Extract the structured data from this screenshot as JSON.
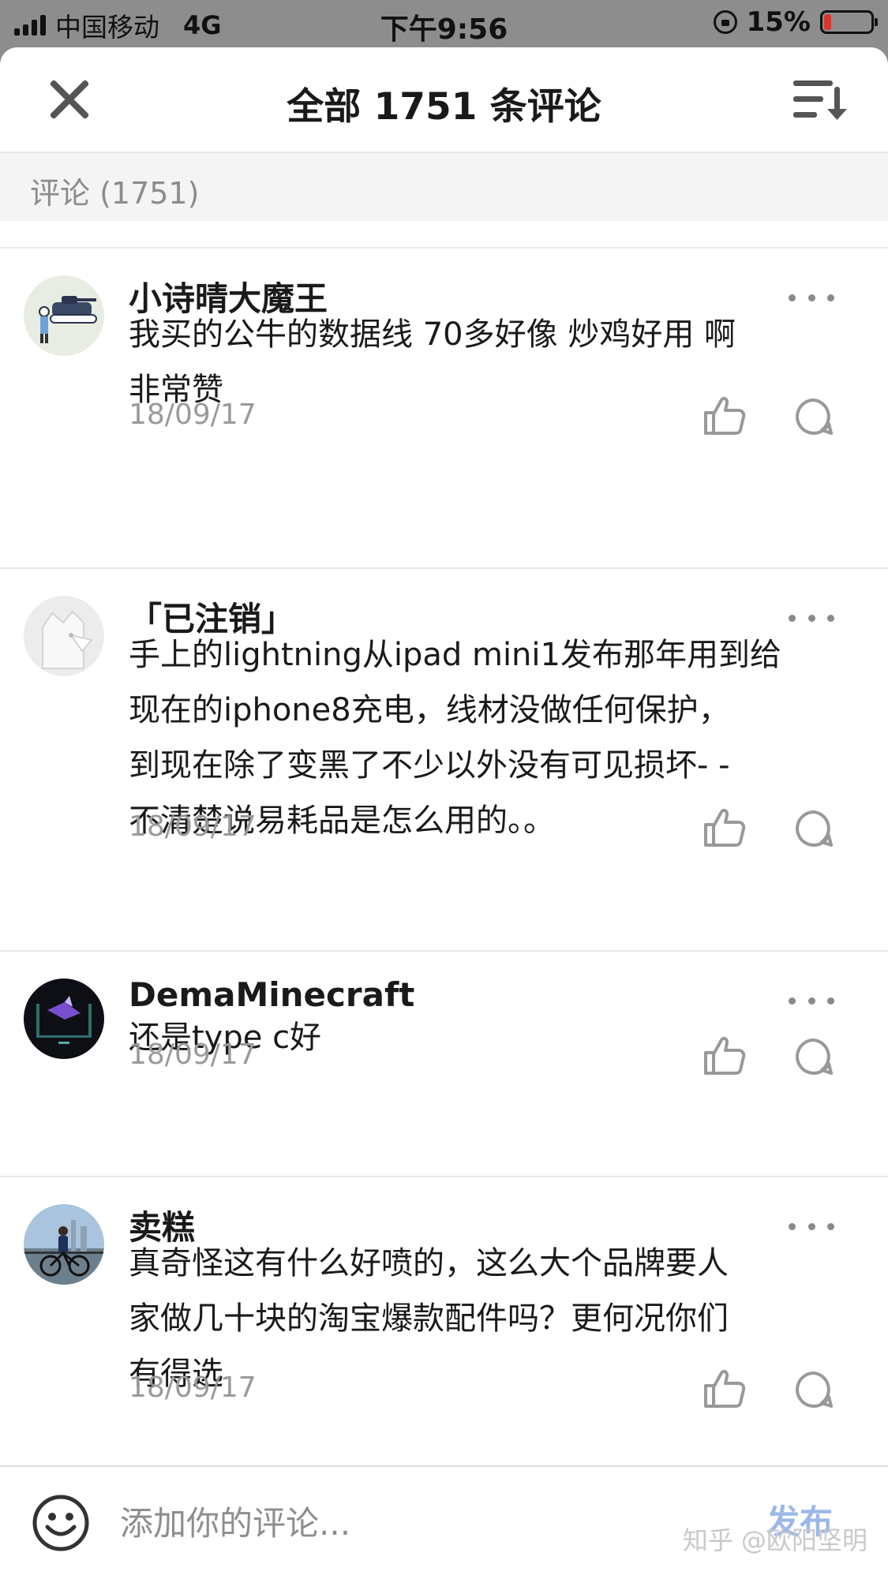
{
  "status_bar": {
    "carrier": "中国移动",
    "network": "4G",
    "time": "下午9:56",
    "battery": "15%"
  },
  "header": {
    "title": "全部 1751 条评论"
  },
  "section": {
    "label": "评论 (1751)"
  },
  "comments": [
    {
      "author": "小诗晴大魔王",
      "lines": [
        "我买的公牛的数据线 70多好像 炒鸡好用 啊",
        "非常赞"
      ],
      "date": "18/09/17"
    },
    {
      "author": "「已注销」",
      "lines": [
        "手上的lightning从ipad mini1发布那年用到给",
        "现在的iphone8充电，线材没做任何保护，",
        "到现在除了变黑了不少以外没有可见损坏- -",
        "不清楚说易耗品是怎么用的。。"
      ],
      "date": "18/09/17"
    },
    {
      "author": "DemaMinecraft",
      "lines": [
        "还是type c好"
      ],
      "date": "18/09/17"
    },
    {
      "author": "卖糕",
      "lines": [
        "真奇怪这有什么好喷的，这么大个品牌要人",
        "家做几十块的淘宝爆款配件吗？更何况你们",
        "有得选"
      ],
      "date": "18/09/17"
    }
  ],
  "footer": {
    "input_placeholder": "添加你的评论...",
    "publish_label": "发布",
    "watermark": "知乎 @欧阳坚明"
  },
  "colors": {
    "status_bar_bg": "#8d8d8d",
    "section_bg": "#f4f4f4",
    "publish_disabled": "#9bb8e8",
    "battery_low": "#e0342a"
  },
  "icons": [
    "close-icon",
    "sort-icon",
    "more-icon",
    "thumbs-up-icon",
    "reply-icon",
    "emoji-icon"
  ]
}
